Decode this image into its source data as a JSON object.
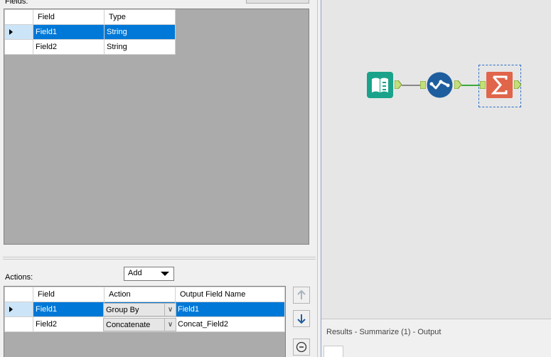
{
  "config": {
    "fields_label": "Fields:",
    "fields_grid": {
      "columns": [
        "Field",
        "Type"
      ],
      "rows": [
        {
          "field": "Field1",
          "type": "String",
          "selected": true
        },
        {
          "field": "Field2",
          "type": "String",
          "selected": false
        }
      ]
    },
    "actions_label": "Actions:",
    "add_dropdown": "Add",
    "actions_grid": {
      "columns": [
        "Field",
        "Action",
        "Output Field Name"
      ],
      "rows": [
        {
          "field": "Field1",
          "action": "Group By",
          "output": "Field1",
          "selected": true
        },
        {
          "field": "Field2",
          "action": "Concatenate",
          "output": "Concat_Field2",
          "selected": false
        }
      ]
    },
    "side_buttons": [
      "move-up-icon",
      "move-down-icon",
      "remove-icon"
    ]
  },
  "canvas": {
    "tools": [
      {
        "name": "input-data-tool",
        "icon": "book-icon",
        "color": "#1aa38a"
      },
      {
        "name": "select-tool",
        "icon": "checkmark-path-icon",
        "color": "#1f5e9e"
      },
      {
        "name": "summarize-tool",
        "icon": "sigma-icon",
        "color": "#e0654a",
        "selected": true
      }
    ]
  },
  "results": {
    "title": "Results - Summarize (1) - Output"
  }
}
